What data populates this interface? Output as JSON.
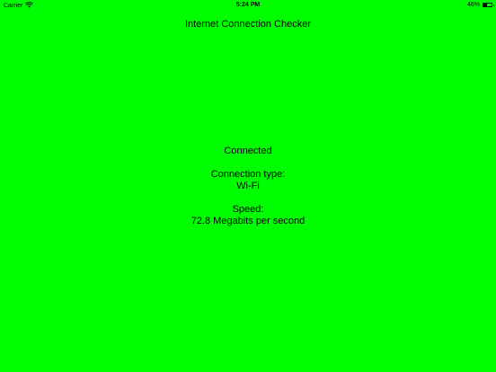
{
  "status_bar": {
    "carrier": "Carrier",
    "time": "5:24 PM",
    "battery_text": "46%",
    "battery_level": 0.46
  },
  "nav": {
    "title": "Internet Connection Checker"
  },
  "main": {
    "status": "Connected",
    "connection_type_label": "Connection type:",
    "connection_type_value": "Wi-Fi",
    "speed_label": "Speed:",
    "speed_value": "72.8 Megabits per second"
  },
  "colors": {
    "background": "#00ff00"
  },
  "icons": {
    "wifi": "wifi-icon",
    "battery": "battery-icon"
  }
}
